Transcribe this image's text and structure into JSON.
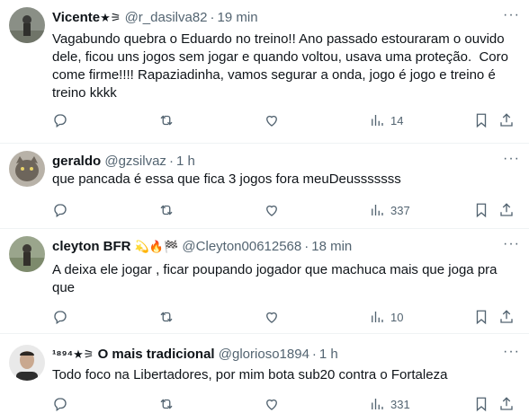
{
  "tweets": [
    {
      "name": "Vicente",
      "name_badge": "★⚞",
      "handle": "@r_dasilva82",
      "time": "19 min",
      "text": "Vagabundo quebra o Eduardo no treino!! Ano passado estouraram o ouvido dele, ficou uns jogos sem jogar e quando voltou, usava uma proteção.  Coro come firme!!!! Rapaziadinha, vamos segurar a onda, jogo é jogo e treino é treino kkkk",
      "views": "14"
    },
    {
      "name": "geraldo",
      "name_badge": "",
      "handle": "@gzsilvaz",
      "time": "1 h",
      "text": "que pancada é essa que fica 3 jogos fora meuDeusssssss",
      "views": "337"
    },
    {
      "name": "cleyton BFR",
      "name_badge": "💫🔥🏁",
      "handle": "@Cleyton00612568",
      "time": "18 min",
      "text": "A deixa ele jogar , ficar poupando jogador que machuca mais que joga pra que",
      "views": "10"
    },
    {
      "name": "O mais tradicional",
      "name_prefix": "¹⁸⁹⁴★⚞",
      "handle": "@glorioso1894",
      "time": "1 h",
      "text": "Todo foco na Libertadores, por mim bota sub20 contra o Fortaleza",
      "views": "331"
    }
  ],
  "icons": [
    "reply-icon",
    "retweet-icon",
    "like-icon",
    "views-icon",
    "bookmark-icon",
    "share-icon",
    "more-icon"
  ],
  "colors": {
    "text": "#0f1419",
    "secondary": "#536471",
    "divider": "#eff3f4"
  }
}
